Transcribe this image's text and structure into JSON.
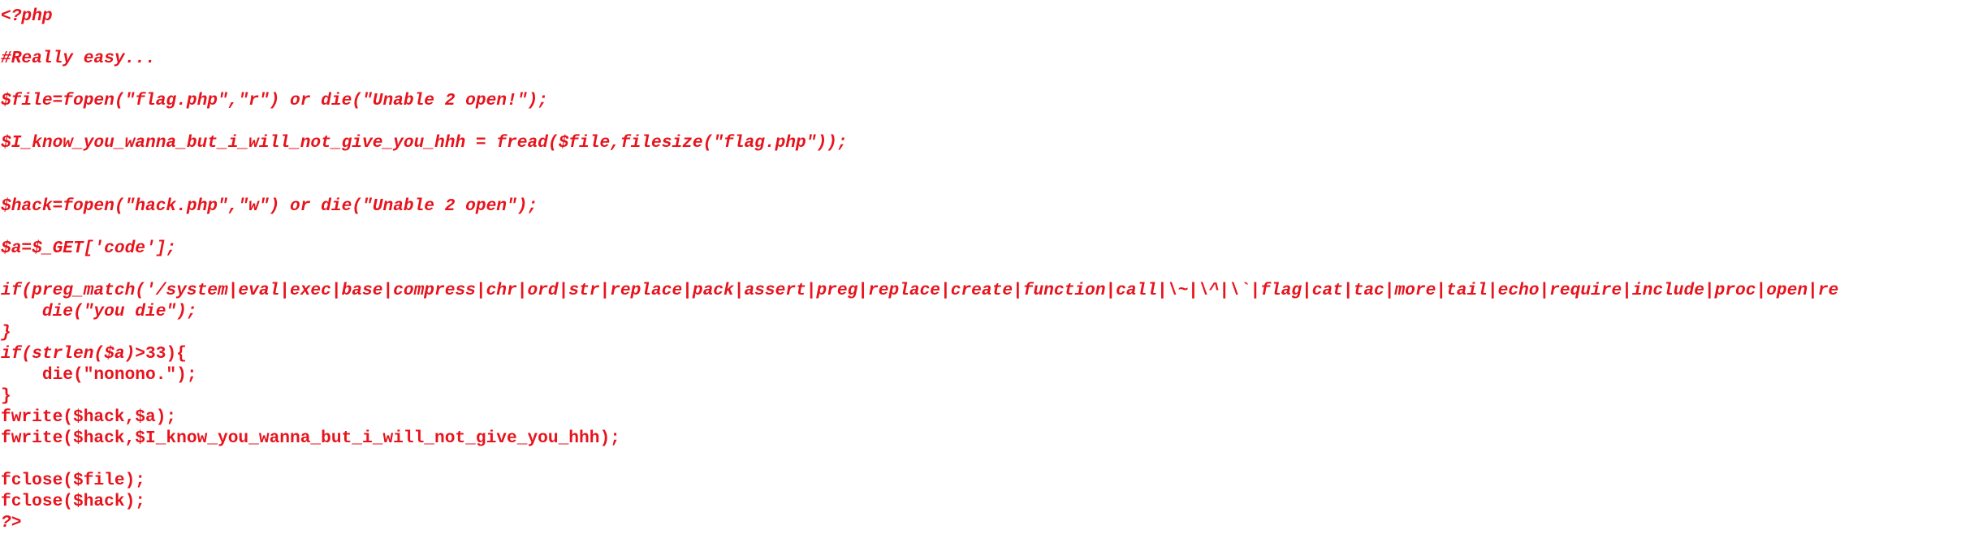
{
  "colors": {
    "text": "#e8131c",
    "background": "#ffffff"
  },
  "code": {
    "lines": [
      "<?php",
      "",
      "#Really easy...",
      "",
      "$file=fopen(\"flag.php\",\"r\") or die(\"Unable 2 open!\");",
      "",
      "$I_know_you_wanna_but_i_will_not_give_you_hhh = fread($file,filesize(\"flag.php\"));",
      "",
      "",
      "$hack=fopen(\"hack.php\",\"w\") or die(\"Unable 2 open\");",
      "",
      "$a=$_GET['code'];",
      "",
      "if(preg_match('/system|eval|exec|base|compress|chr|ord|str|replace|pack|assert|preg|replace|create|function|call|\\~|\\^|\\`|flag|cat|tac|more|tail|echo|require|include|proc|open|re",
      "    die(\"you die\");",
      "}",
      "if(strlen($a)>33){",
      "    die(\"nonono.\");",
      "}",
      "fwrite($hack,$a);",
      "fwrite($hack,$I_know_you_wanna_but_i_will_not_give_you_hhh);",
      "",
      "fclose($file);",
      "fclose($hack);",
      "?>"
    ],
    "italic_flags": [
      true,
      false,
      true,
      false,
      true,
      false,
      true,
      false,
      false,
      true,
      false,
      true,
      false,
      true,
      true,
      true,
      "mixed",
      false,
      false,
      false,
      false,
      false,
      false,
      false,
      true
    ]
  }
}
